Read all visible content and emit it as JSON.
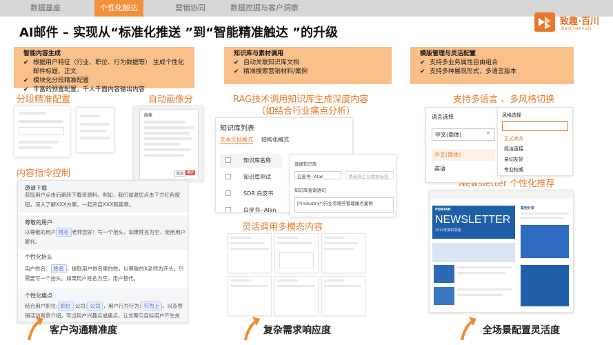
{
  "nav": {
    "tabs": [
      "数据基座",
      "个性化触达",
      "营销协同",
      "数据挖掘与客户洞察"
    ],
    "active_index": 1
  },
  "brand": {
    "name": "致趣·百川",
    "sub": "BesChannels"
  },
  "title": "AI邮件 – 实现从“标准化推送 ”到“智能精准触达 ”的升级",
  "features": [
    {
      "heading": "智能内容生成",
      "items": [
        "根据用户特征（行业、职位、行为数据等） 生成个性化邮件标题、正文",
        "模块化分段精准配置",
        "丰富的预置配置，千人千面内容输出内容"
      ]
    },
    {
      "heading": "知识库与素材调用",
      "items": [
        "自动关联知识库文档",
        "精准搜索营销材料/案例"
      ]
    },
    {
      "heading": "模版管理与灵活配置",
      "items": [
        "支持多业务属性自由组合",
        "支持多种展现形式，多语言版本"
      ]
    }
  ],
  "section_labels": {
    "segment": "分段精准配置",
    "segment_tail": "析",
    "auto_portrait": "自动画像分",
    "instruction": "内容指令控制",
    "rag_line1": "RAG技术调用知识库生成深度内容",
    "rag_line2": "（如结合行业痛点分析）",
    "multilang": "支持多语言 、多风格切换",
    "newsletter": "Newsletter 个性化推荐",
    "multimodal": "灵活调用多模态内容"
  },
  "instruction_panel": {
    "s1_head": "邀请下载",
    "s1_body": "获取用户点击后跳转下载资源料，例如，我们诚邀您点击下方红色按钮，深入了解XXX方案，一起开启XXX新篇章。",
    "s2_head": "尊敬的用户",
    "s2_pre": "以尊敬的用户",
    "s2_tag": "姓名",
    "s2_post": "老师您好！写一个抬头，如果姓名为空，使用用户昵代。",
    "s3_head": "个性化抬头",
    "s3_pre": "用户姓名：",
    "s3_tag": "姓名",
    "s3_post": "，提取用户姓名里的姓，以尊敬的X老师为开头，只需要写一个抬头。如果用户姓名为空，用户替代。",
    "s4_head": "个性化痛点",
    "s4_pre": "结合用户职位:",
    "s4_tag1": "职位",
    "s4_mid1": "公司:",
    "s4_tag2": "公司",
    "s4_mid2": "，用户行为行为:",
    "s4_tag3": "行为上",
    "s4_post": "，以及营销活动背景介绍，写出用户兴趣点或痛点，让文案与目标用户产生关联；不要..."
  },
  "kb": {
    "title": "知识库列表",
    "tab1": "文本文档格式",
    "tab2": "结构化格式",
    "rows": [
      "知识库名称",
      "知识库测试",
      "SDR 白皮书",
      "白皮书--Alan"
    ],
    "sub_label1": "选择知识库",
    "sub_value1": "白皮书--Alan",
    "sub_hint": "请选择企业数据标签",
    "sub_label2": "知识库查询语句",
    "sub_query": "[*industry*]行业有哪些管理痛点案例"
  },
  "lang_panel": {
    "label": "语言选择",
    "selected": "中文(简体)",
    "options": [
      "中文(简体)",
      "英语"
    ]
  },
  "style_panel": {
    "label": "风格选择",
    "options": [
      "正式商务",
      "简洁直接",
      "亲切友好",
      "专业权威"
    ]
  },
  "newsletter_mock": {
    "brand": "PORTAN",
    "heading": "NEWSLETTER",
    "sub": "2024年第四季度",
    "side_title": "案例分享"
  },
  "modal": {
    "title": "画像",
    "cancel": "取消",
    "ok": "确定"
  },
  "outcomes": [
    "客户沟通精准度",
    "复杂需求响应度",
    "全场景配置灵活度"
  ],
  "colors": {
    "accent": "#f3913b",
    "feature_bg": "#f9c08a",
    "label": "#e57a2a"
  },
  "icons": [
    "check-icon",
    "arrow-up-icon",
    "brand-logo-icon"
  ]
}
